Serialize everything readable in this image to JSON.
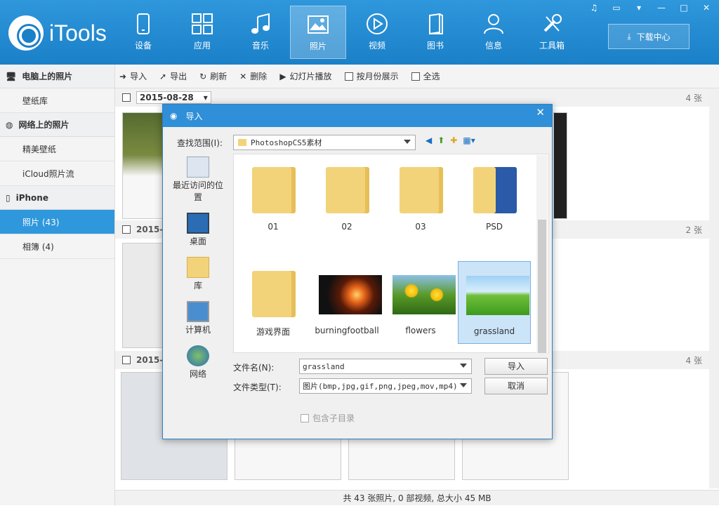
{
  "app": {
    "name": "iTools"
  },
  "nav": [
    {
      "label": "设备",
      "icon": "device-icon"
    },
    {
      "label": "应用",
      "icon": "apps-icon"
    },
    {
      "label": "音乐",
      "icon": "music-icon"
    },
    {
      "label": "照片",
      "icon": "photo-icon"
    },
    {
      "label": "视频",
      "icon": "video-icon"
    },
    {
      "label": "图书",
      "icon": "book-icon"
    },
    {
      "label": "信息",
      "icon": "person-icon"
    },
    {
      "label": "工具箱",
      "icon": "toolbox-icon"
    }
  ],
  "download_center": "下载中心",
  "sidebar": {
    "sections": [
      {
        "title": "电脑上的照片",
        "items": [
          "壁纸库"
        ]
      },
      {
        "title": "网络上的照片",
        "items": [
          "精美壁纸",
          "iCloud照片流"
        ]
      },
      {
        "title": "iPhone",
        "items": [
          "照片 (43)",
          "相簿 (4)"
        ]
      }
    ]
  },
  "toolbar": {
    "import": "导入",
    "export": "导出",
    "refresh": "刷新",
    "delete": "删除",
    "slideshow": "幻灯片播放",
    "by_month": "按月份展示",
    "select_all": "全选"
  },
  "groups": [
    {
      "date": "2015-08-28",
      "count": "4 张"
    },
    {
      "date": "2015-",
      "count": "2 张"
    },
    {
      "date": "2015-",
      "count": "4 张"
    }
  ],
  "status": "共 43 张照片, 0 部视频, 总大小 45 MB",
  "dialog": {
    "title": "导入",
    "lookin_label": "查找范围(I):",
    "lookin_value": "PhotoshopCS5素材",
    "places": [
      "最近访问的位置",
      "桌面",
      "库",
      "计算机",
      "网络"
    ],
    "files": [
      "01",
      "02",
      "03",
      "PSD",
      "游戏界面",
      "burningfootball",
      "flowers",
      "grassland"
    ],
    "filename_label": "文件名(N):",
    "filename_value": "grassland",
    "filetype_label": "文件类型(T):",
    "filetype_value": "图片(bmp,jpg,gif,png,jpeg,mov,mp4)",
    "open_button": "导入",
    "cancel_button": "取消",
    "subdir_label": "包含子目录"
  },
  "colors": {
    "accent": "#2f97dc",
    "selected": "#cce4f7"
  }
}
